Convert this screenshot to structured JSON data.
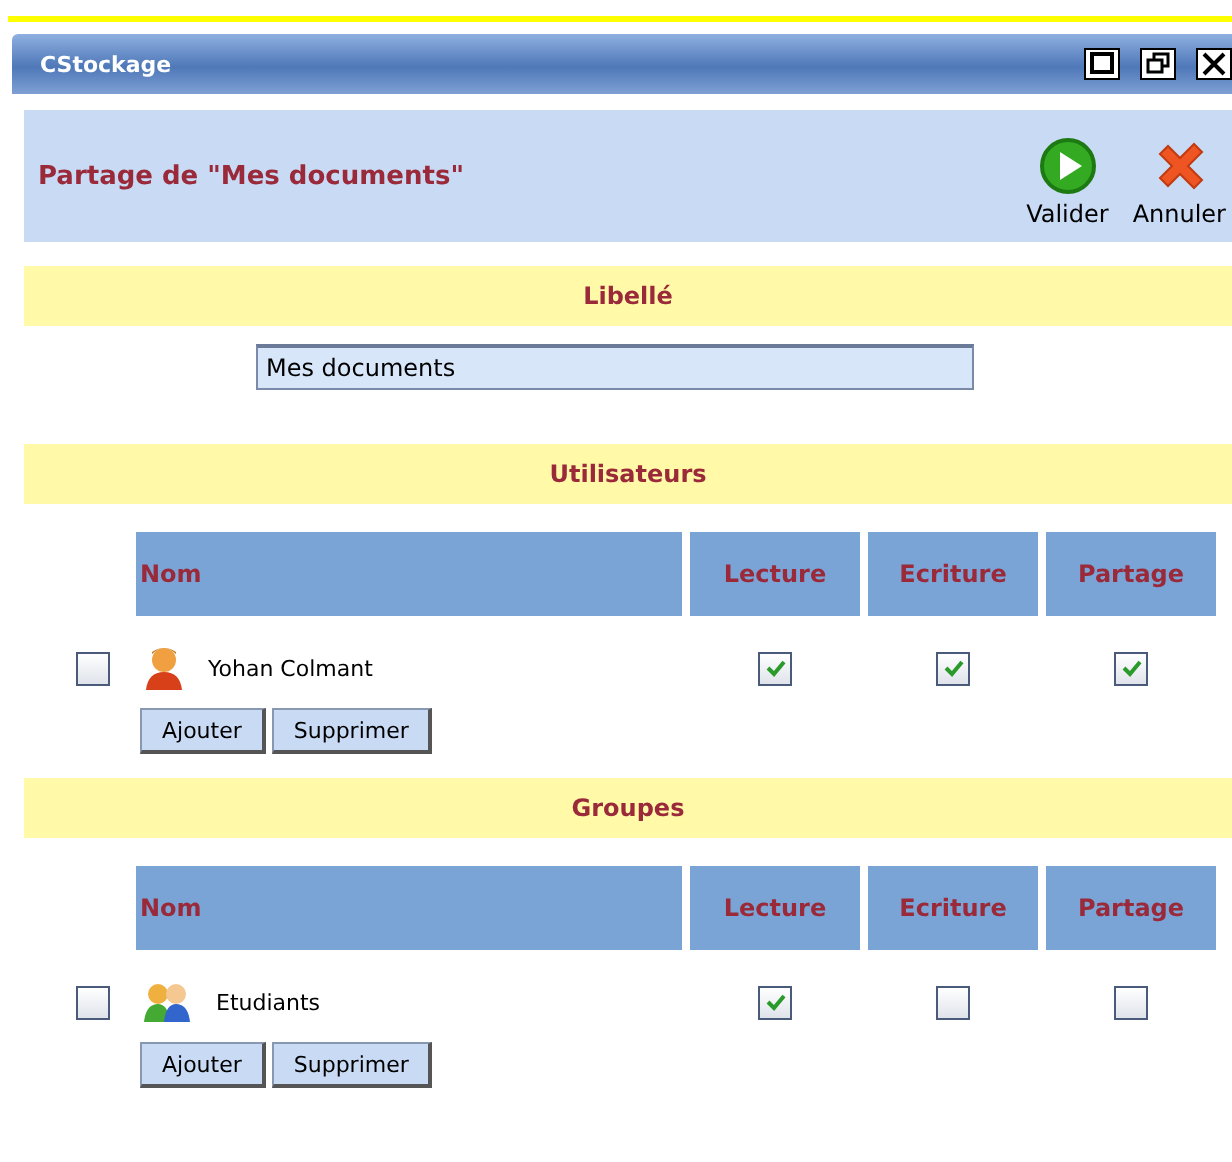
{
  "window": {
    "title": "CStockage",
    "controls": [
      {
        "kind": "maximize"
      },
      {
        "kind": "restore"
      },
      {
        "kind": "close"
      }
    ]
  },
  "header": {
    "title": "Partage de \"Mes documents\"",
    "actions": [
      {
        "kind": "validate",
        "label": "Valider"
      },
      {
        "kind": "cancel",
        "label": "Annuler"
      }
    ]
  },
  "label_section": {
    "title": "Libellé",
    "value": "Mes documents"
  },
  "tables": [
    {
      "title": "Utilisateurs",
      "columns": [
        "Nom",
        "Lecture",
        "Ecriture",
        "Partage"
      ],
      "rows": [
        {
          "kind": "user",
          "name": "Yohan Colmant",
          "checked": false,
          "permissions": [
            true,
            true,
            true
          ]
        }
      ],
      "buttons": [
        "Ajouter",
        "Supprimer"
      ]
    },
    {
      "title": "Groupes",
      "columns": [
        "Nom",
        "Lecture",
        "Ecriture",
        "Partage"
      ],
      "rows": [
        {
          "kind": "group",
          "name": "Etudiants",
          "checked": false,
          "permissions": [
            true,
            false,
            false
          ]
        }
      ],
      "buttons": [
        "Ajouter",
        "Supprimer"
      ]
    }
  ]
}
